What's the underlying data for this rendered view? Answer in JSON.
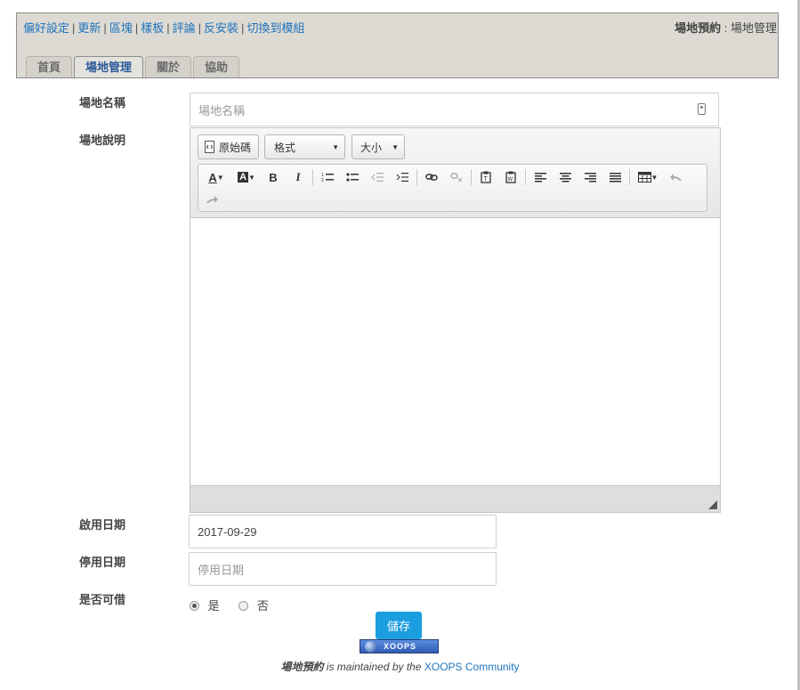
{
  "admin_nav": {
    "links": [
      "偏好設定",
      "更新",
      "區塊",
      "樣板",
      "評論",
      "反安裝",
      "切換到模組"
    ],
    "separator": "|"
  },
  "breadcrumb": {
    "module": "場地預約",
    "separator": " : ",
    "page": "場地管理"
  },
  "tabs": [
    {
      "label": "首頁",
      "active": false
    },
    {
      "label": "場地管理",
      "active": true
    },
    {
      "label": "關於",
      "active": false
    },
    {
      "label": "協助",
      "active": false
    }
  ],
  "form": {
    "name": {
      "label": "場地名稱",
      "value": "",
      "placeholder": "場地名稱"
    },
    "description": {
      "label": "場地說明"
    },
    "start_date": {
      "label": "啟用日期",
      "value": "2017-09-29",
      "placeholder": ""
    },
    "end_date": {
      "label": "停用日期",
      "value": "",
      "placeholder": "停用日期"
    },
    "borrowable": {
      "label": "是否可借",
      "options": [
        {
          "label": "是",
          "checked": true
        },
        {
          "label": "否",
          "checked": false
        }
      ]
    },
    "submit_label": "儲存"
  },
  "editor": {
    "source_label": "原始碼",
    "format_label": "格式",
    "size_label": "大小",
    "toolbar_icons": [
      "text-color-icon",
      "bg-color-icon",
      "bold-icon",
      "italic-icon",
      "numbered-list-icon",
      "bulleted-list-icon",
      "outdent-icon",
      "indent-icon",
      "link-icon",
      "unlink-icon",
      "paste-text-icon",
      "paste-word-icon",
      "align-left-icon",
      "align-center-icon",
      "align-right-icon",
      "justify-icon",
      "table-icon",
      "undo-icon",
      "redo-icon"
    ]
  },
  "footer": {
    "badge_text": "XOOPS",
    "module_name": "場地預約",
    "maintained_text": " is maintained by the ",
    "community_link": "XOOPS Community"
  },
  "colors": {
    "accent": "#1a9ee0",
    "link": "#1e73be",
    "header_bg": "#dcdad3"
  }
}
